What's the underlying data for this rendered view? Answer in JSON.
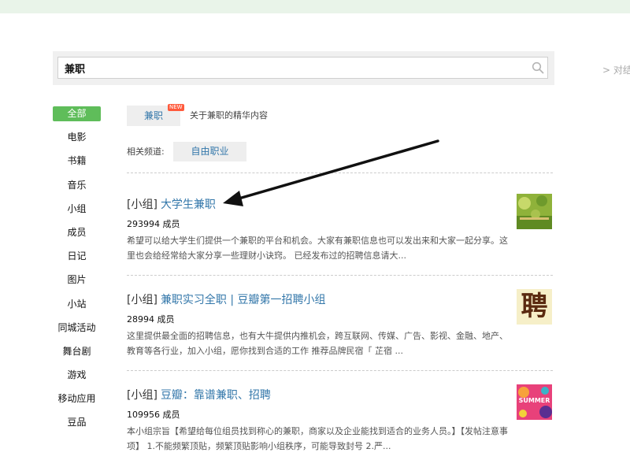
{
  "search": {
    "value": "兼职"
  },
  "side_link": "> 对结",
  "nav": {
    "items": [
      {
        "label": "全部",
        "active": true
      },
      {
        "label": "电影"
      },
      {
        "label": "书籍"
      },
      {
        "label": "音乐"
      },
      {
        "label": "小组"
      },
      {
        "label": "成员"
      },
      {
        "label": "日记"
      },
      {
        "label": "图片"
      },
      {
        "label": "小站"
      },
      {
        "label": "同城活动"
      },
      {
        "label": "舞台剧"
      },
      {
        "label": "游戏"
      },
      {
        "label": "移动应用"
      },
      {
        "label": "豆品"
      }
    ]
  },
  "tag": {
    "label": "兼职",
    "badge": "NEW",
    "desc": "关于兼职的精华内容"
  },
  "related": {
    "label": "相关频道:",
    "chip": "自由职业"
  },
  "results": [
    {
      "type": "[小组]",
      "name": "大学生兼职",
      "members": "293994 成员",
      "desc": "希望可以给大学生们提供一个兼职的平台和机会。大家有兼职信息也可以发出来和大家一起分享。这里也会给经常给大家分享一些理财小诀窍。 已经发布过的招聘信息请大..."
    },
    {
      "type": "[小组]",
      "name": "兼职实习全职 | 豆瓣第一招聘小组",
      "members": "28994 成员",
      "desc": "这里提供最全面的招聘信息，也有大牛提供内推机会，跨互联网、传媒、广告、影视、金融、地产、教育等各行业，加入小组，愿你找到合适的工作 推荐品牌民宿「 芷宿 ...",
      "thumb_text": "聘"
    },
    {
      "type": "[小组]",
      "name": "豆瓣：靠谱兼职、招聘",
      "members": "109956 成员",
      "desc": "本小组宗旨【希望给每位组员找到称心的兼职，商家以及企业能找到适合的业务人员。】【发帖注意事项】 1.不能频繁顶贴，频繁顶贴影响小组秩序，可能导致封号 2.严...",
      "thumb_text": "SUMMER"
    }
  ],
  "colors": {
    "accent_green": "#5fbd5a",
    "link_blue": "#3377aa",
    "topbar": "#e9f4e9"
  }
}
